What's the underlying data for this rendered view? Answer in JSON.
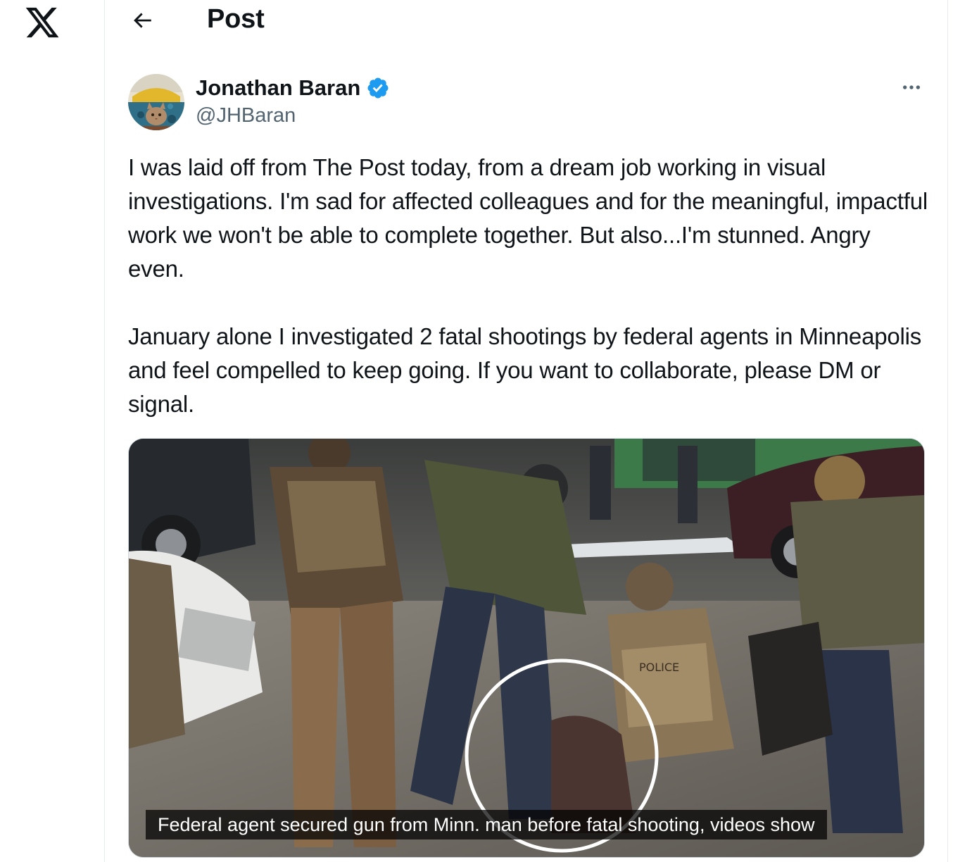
{
  "app": {
    "logo_icon": "x-logo-icon"
  },
  "header": {
    "back_icon": "arrow-left-icon",
    "title": "Post"
  },
  "post": {
    "author": {
      "name": "Jonathan Baran",
      "handle": "@JHBaran",
      "verified": true,
      "verified_icon": "verified-badge-icon",
      "verified_color": "#1d9bf0"
    },
    "more_icon": "more-horizontal-icon",
    "paragraphs": [
      "I was laid off from The Post today, from a dream job working in visual investigations. I'm sad for affected colleagues and for the meaningful, impactful work we won't be able to complete together. But also...I'm stunned. Angry even.",
      "January alone I investigated 2 fatal shootings by federal agents in Minneapolis and feel compelled to keep going. If you want to collaborate, please DM or signal."
    ],
    "media": {
      "caption": "Federal agent secured gun from Minn. man before fatal shooting, videos show",
      "highlight_icon": "circle-highlight-icon",
      "patch_text": "POLICE"
    }
  },
  "colors": {
    "text_primary": "#0f1419",
    "text_secondary": "#536471",
    "border": "#e6ecf0",
    "accent": "#1d9bf0"
  }
}
